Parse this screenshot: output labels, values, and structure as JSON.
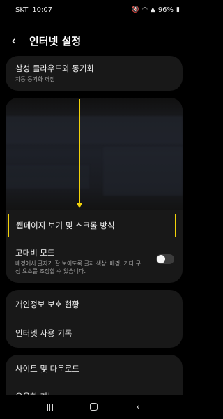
{
  "status": {
    "carrier": "SKT",
    "time": "10:07",
    "battery": "96%",
    "icons": [
      "mute-icon",
      "wifi-icon",
      "signal-icon",
      "battery-icon"
    ]
  },
  "header": {
    "back_icon": "back-arrow-icon",
    "title": "인터넷 설정"
  },
  "cloud": {
    "title": "삼성 클라우드와 동기화",
    "subtitle": "자동 동기화 꺼짐"
  },
  "display": {
    "highlighted": "웹페이지 보기 및 스크롤 방식",
    "accent_color": "#f2d20a",
    "high_contrast": {
      "title": "고대비 모드",
      "subtitle": "배경에서 글자가 잘 보이도록 글자 색상, 배경, 기타 구성 요소를 조정할 수 있습니다.",
      "enabled": false
    }
  },
  "privacy": {
    "items": [
      "개인정보 보호 현황",
      "인터넷 사용 기록"
    ]
  },
  "sites": {
    "items": [
      "사이트 및 다운로드",
      "유용한 기능"
    ]
  },
  "nav": {
    "recent": "recent-apps-icon",
    "home": "home-icon",
    "back": "back-icon"
  }
}
